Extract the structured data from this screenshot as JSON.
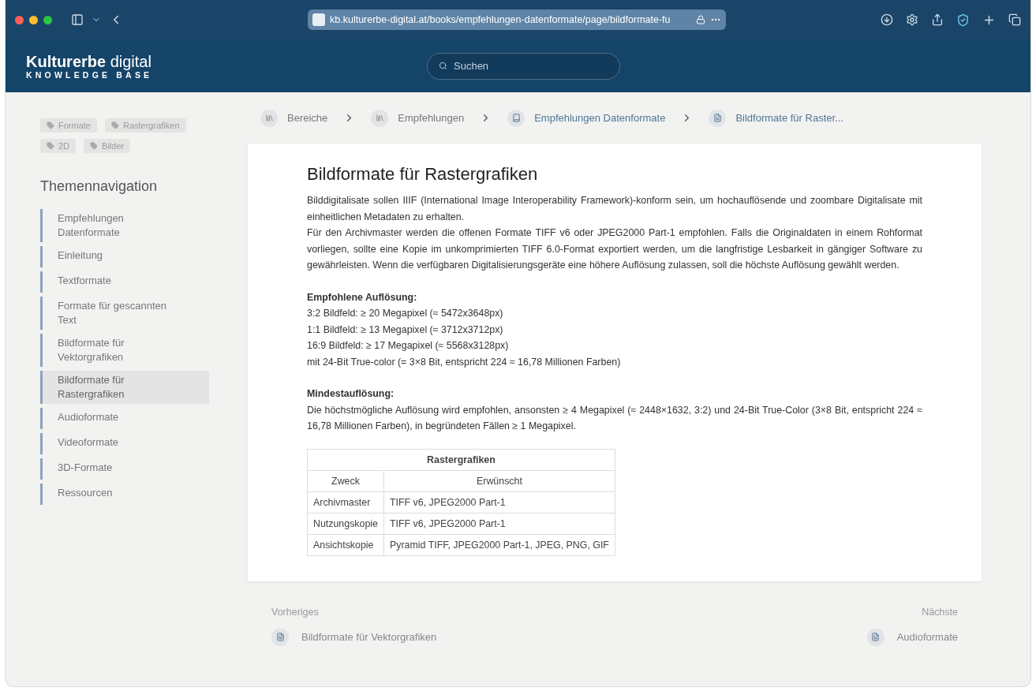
{
  "browser": {
    "url": "kb.kulturerbe-digital.at/books/empfehlungen-datenformate/page/bildformate-fu"
  },
  "header": {
    "logo": "**Kulturerbe** digital",
    "subtitle": "KNOWLEDGE BASE",
    "search": {
      "placeholder": "Suchen"
    }
  },
  "tags": [
    "Formate",
    "Rastergrafiken",
    "2D",
    "Bilder"
  ],
  "navigation": {
    "title": "Themennavigation",
    "items": [
      {
        "label": "Empfehlungen Datenformate",
        "selected": false
      },
      {
        "label": "Einleitung",
        "selected": false
      },
      {
        "label": "Textformate",
        "selected": false
      },
      {
        "label": "Formate für gescannten Text",
        "selected": false
      },
      {
        "label": "Bildformate für Vektorgrafiken",
        "selected": false
      },
      {
        "label": "Bildformate für Rastergrafiken",
        "selected": true
      },
      {
        "label": "Audioformate",
        "selected": false
      },
      {
        "label": "Videoformate",
        "selected": false
      },
      {
        "label": "3D-Formate",
        "selected": false
      },
      {
        "label": "Ressourcen",
        "selected": false
      }
    ]
  },
  "breadcrumbs": [
    {
      "label": "Bereiche",
      "kind": "shelves"
    },
    {
      "label": "Empfehlungen",
      "kind": "shelves"
    },
    {
      "label": "Empfehlungen Datenformate",
      "kind": "book"
    },
    {
      "label": "Bildformate für Raster...",
      "kind": "page"
    }
  ],
  "article": {
    "title": "Bildformate für Rastergrafiken",
    "paragraphs": [
      "Bilddigitalisate sollen IIIF (International Image Interoperability Framework)-konform sein, um hochauflösende und zoombare Digitalisate mit einheitlichen Metadaten zu erhalten.",
      "Für den Archivmaster werden die offenen Formate TIFF v6 oder JPEG2000 Part-1 empfohlen. Falls die Originaldaten in einem Rohformat vorliegen, sollte eine Kopie im unkomprimierten TIFF 6.0-Format exportiert werden, um die langfristige Lesbarkeit in gängiger Software zu gewährleisten. Wenn die verfügbaren Digitalisierungsgeräte eine höhere Auflösung zulassen, soll die höchste Auflösung gewählt werden."
    ],
    "sections": [
      {
        "heading": "Empfohlene Auflösung:",
        "lines": [
          "3:2 Bildfeld: ≥ 20 Megapixel (≈ 5472x3648px)",
          "1:1 Bildfeld: ≥ 13 Megapixel (≈ 3712x3712px)",
          "16:9 Bildfeld: ≥ 17 Megapixel (≈ 5568x3128px)",
          "mit 24-Bit True-color (= 3×8 Bit, entspricht 224 ≈ 16,78 Millionen Farben)"
        ]
      },
      {
        "heading": "Mindestauflösung:",
        "lines": [
          "Die höchstmögliche Auflösung wird empfohlen, ansonsten ≥ 4 Megapixel (≈ 2448×1632, 3:2) und 24-Bit True-Color (3×8 Bit, entspricht 224 ≈ 16,78 Millionen Farben), in begründeten Fällen ≥ 1 Megapixel."
        ]
      }
    ],
    "table": {
      "caption": "Rastergrafiken",
      "columns": [
        "Zweck",
        "Erwünscht"
      ],
      "rows": [
        [
          "Archivmaster",
          "TIFF v6, JPEG2000 Part-1"
        ],
        [
          "Nutzungskopie",
          "TIFF v6, JPEG2000 Part-1"
        ],
        [
          "Ansichtskopie",
          "Pyramid TIFF, JPEG2000 Part-1, JPEG, PNG, GIF"
        ]
      ]
    }
  },
  "pager": {
    "previous": {
      "label": "Vorheriges",
      "title": "Bildformate für Vektorgrafiken"
    },
    "next": {
      "label": "Nächste",
      "title": "Audioformate"
    }
  }
}
